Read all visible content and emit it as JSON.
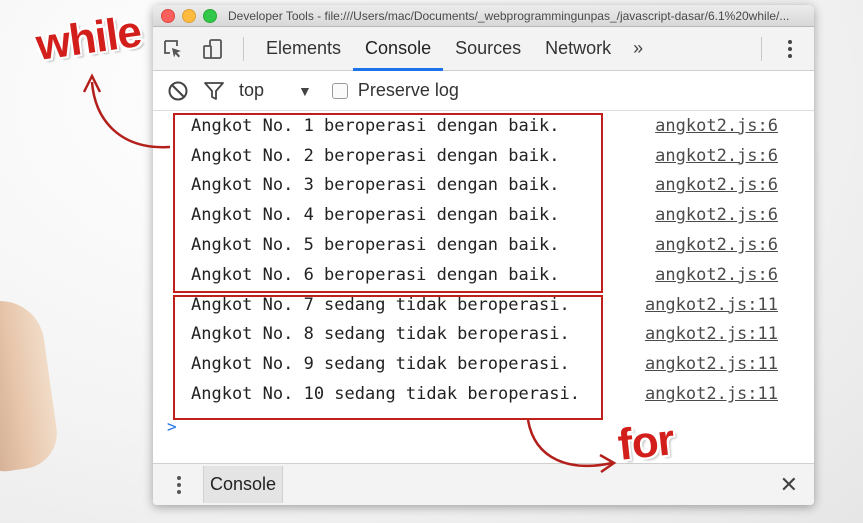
{
  "window": {
    "title": "Developer Tools - file:///Users/mac/Documents/_webprogrammingunpas_/javascript-dasar/6.1%20while/..."
  },
  "tabs": [
    "Elements",
    "Console",
    "Sources",
    "Network"
  ],
  "active_tab": "Console",
  "more_tabs": "»",
  "toolbar": {
    "context": "top",
    "caret": "▼",
    "preserve_log": "Preserve log"
  },
  "logs": [
    {
      "text": "Angkot No. 1 beroperasi dengan baik.",
      "source": "angkot2.js:6"
    },
    {
      "text": "Angkot No. 2 beroperasi dengan baik.",
      "source": "angkot2.js:6"
    },
    {
      "text": "Angkot No. 3 beroperasi dengan baik.",
      "source": "angkot2.js:6"
    },
    {
      "text": "Angkot No. 4 beroperasi dengan baik.",
      "source": "angkot2.js:6"
    },
    {
      "text": "Angkot No. 5 beroperasi dengan baik.",
      "source": "angkot2.js:6"
    },
    {
      "text": "Angkot No. 6 beroperasi dengan baik.",
      "source": "angkot2.js:6"
    },
    {
      "text": "Angkot No. 7 sedang tidak beroperasi.",
      "source": "angkot2.js:11"
    },
    {
      "text": "Angkot No. 8 sedang tidak beroperasi.",
      "source": "angkot2.js:11"
    },
    {
      "text": "Angkot No. 9 sedang tidak beroperasi.",
      "source": "angkot2.js:11"
    },
    {
      "text": "Angkot No. 10 sedang tidak beroperasi.",
      "source": "angkot2.js:11"
    }
  ],
  "prompt": ">",
  "drawer": {
    "tab": "Console",
    "close": "✕"
  },
  "annotations": {
    "while": "while",
    "for": "for",
    "color": "#d21f1b"
  },
  "colors": {
    "accent": "#1a73e8",
    "box": "#c0201b"
  }
}
